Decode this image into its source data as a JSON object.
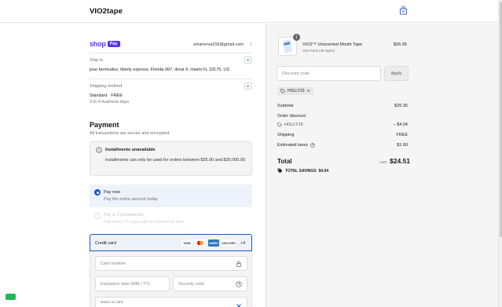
{
  "header": {
    "brand": "VIO2tape",
    "cart_icon": "shopping-bag-icon"
  },
  "shop_pay": {
    "shop_word": "shop",
    "pay_badge": "Pay",
    "email": "smarnova159@gmail.com"
  },
  "ship_to": {
    "label": "Ship to",
    "address": "jose bermudez, liberty express, Florida 997, doral 9, miami FL 33175, US"
  },
  "shipping_method": {
    "label": "Shipping method",
    "method": "Standard · FREE",
    "eta": "3 to 4 business days"
  },
  "payment": {
    "title": "Payment",
    "subtitle": "All transactions are secure and encrypted.",
    "notice": {
      "title": "Installments unavailable",
      "body": "Installments can only be used for orders between $35.00 and $30,000.00."
    },
    "options": [
      {
        "title": "Pay now",
        "subtitle": "Pay the entire amount today",
        "selected": true
      },
      {
        "title": "Pay in 2 installments",
        "subtitle": "Pay every 15 days with no interest or fees",
        "selected": false
      }
    ],
    "credit_card": {
      "label": "Credit card",
      "brands": [
        "VISA",
        "MC",
        "AMEX",
        "DISCOVER"
      ],
      "more": "+4",
      "card_number_placeholder": "Card number",
      "expiry_placeholder": "Expiration date (MM / YY)",
      "security_placeholder": "Security code",
      "name_label": "Name on card"
    }
  },
  "order": {
    "quantity": "1",
    "product_name": "VIO2™ Unscented Mouth Tape",
    "product_variant": "One Pack (48 tapes)",
    "product_price": "$26.95",
    "discount_placeholder": "Discount code",
    "apply_label": "Apply",
    "applied_code": "HOLLY15",
    "subtotal_label": "Subtotal",
    "subtotal_value": "$26.95",
    "order_discount_label": "Order discount",
    "discount_code": "HOLLY15",
    "discount_value": "– $4.04",
    "shipping_label": "Shipping",
    "shipping_value": "FREE",
    "taxes_label": "Estimated taxes",
    "taxes_value": "$1.60",
    "total_label": "Total",
    "currency": "USD",
    "total_value": "$24.51",
    "savings_label": "TOTAL SAVINGS",
    "savings_value": "$4.04"
  },
  "colors": {
    "accent": "#1a56c7",
    "shop_purple": "#5a31f4",
    "panel": "#f5f5f5"
  }
}
